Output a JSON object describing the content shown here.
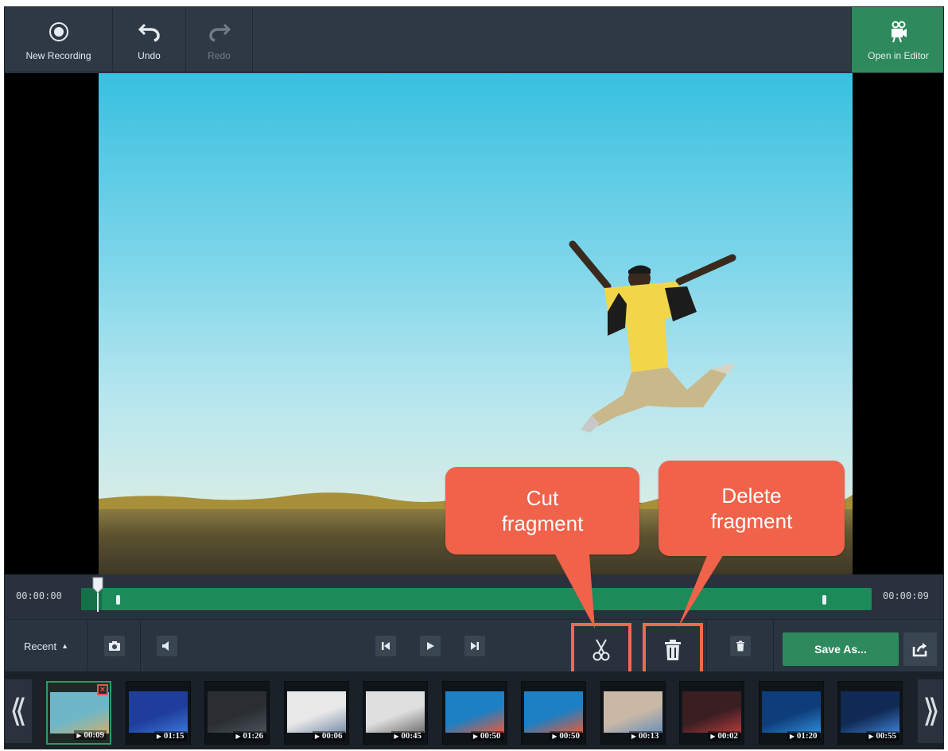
{
  "toolbar": {
    "new_recording": "New Recording",
    "undo": "Undo",
    "redo": "Redo",
    "open_in_editor": "Open in Editor"
  },
  "callouts": {
    "cut_line1": "Cut",
    "cut_line2": "fragment",
    "delete_line1": "Delete",
    "delete_line2": "fragment"
  },
  "timeline": {
    "start_time": "00:00:00",
    "end_time": "00:00:09"
  },
  "controls": {
    "recent_label": "Recent",
    "save_as": "Save As..."
  },
  "thumbnails": [
    {
      "duration": "00:09",
      "selected": true
    },
    {
      "duration": "01:15"
    },
    {
      "duration": "01:26"
    },
    {
      "duration": "00:06"
    },
    {
      "duration": "00:45"
    },
    {
      "duration": "00:50"
    },
    {
      "duration": "00:50"
    },
    {
      "duration": "00:13"
    },
    {
      "duration": "00:02"
    },
    {
      "duration": "01:20"
    },
    {
      "duration": "00:55"
    }
  ],
  "nav": {
    "left": "⟪",
    "right": "⟫"
  },
  "icons": {
    "new_recording": "record-icon",
    "undo": "undo-icon",
    "redo": "redo-icon",
    "open_in_editor": "film-editor-icon",
    "snapshot": "camera-icon",
    "volume": "speaker-icon",
    "previous": "skip-previous-icon",
    "play": "play-icon",
    "next": "skip-next-icon",
    "cut": "scissors-icon",
    "delete": "trash-icon",
    "export": "share-icon"
  },
  "colors": {
    "accent_green": "#2e8a5c",
    "callout": "#f0624a",
    "highlight_box": "#ef6a4e",
    "panel": "#2b3541"
  }
}
